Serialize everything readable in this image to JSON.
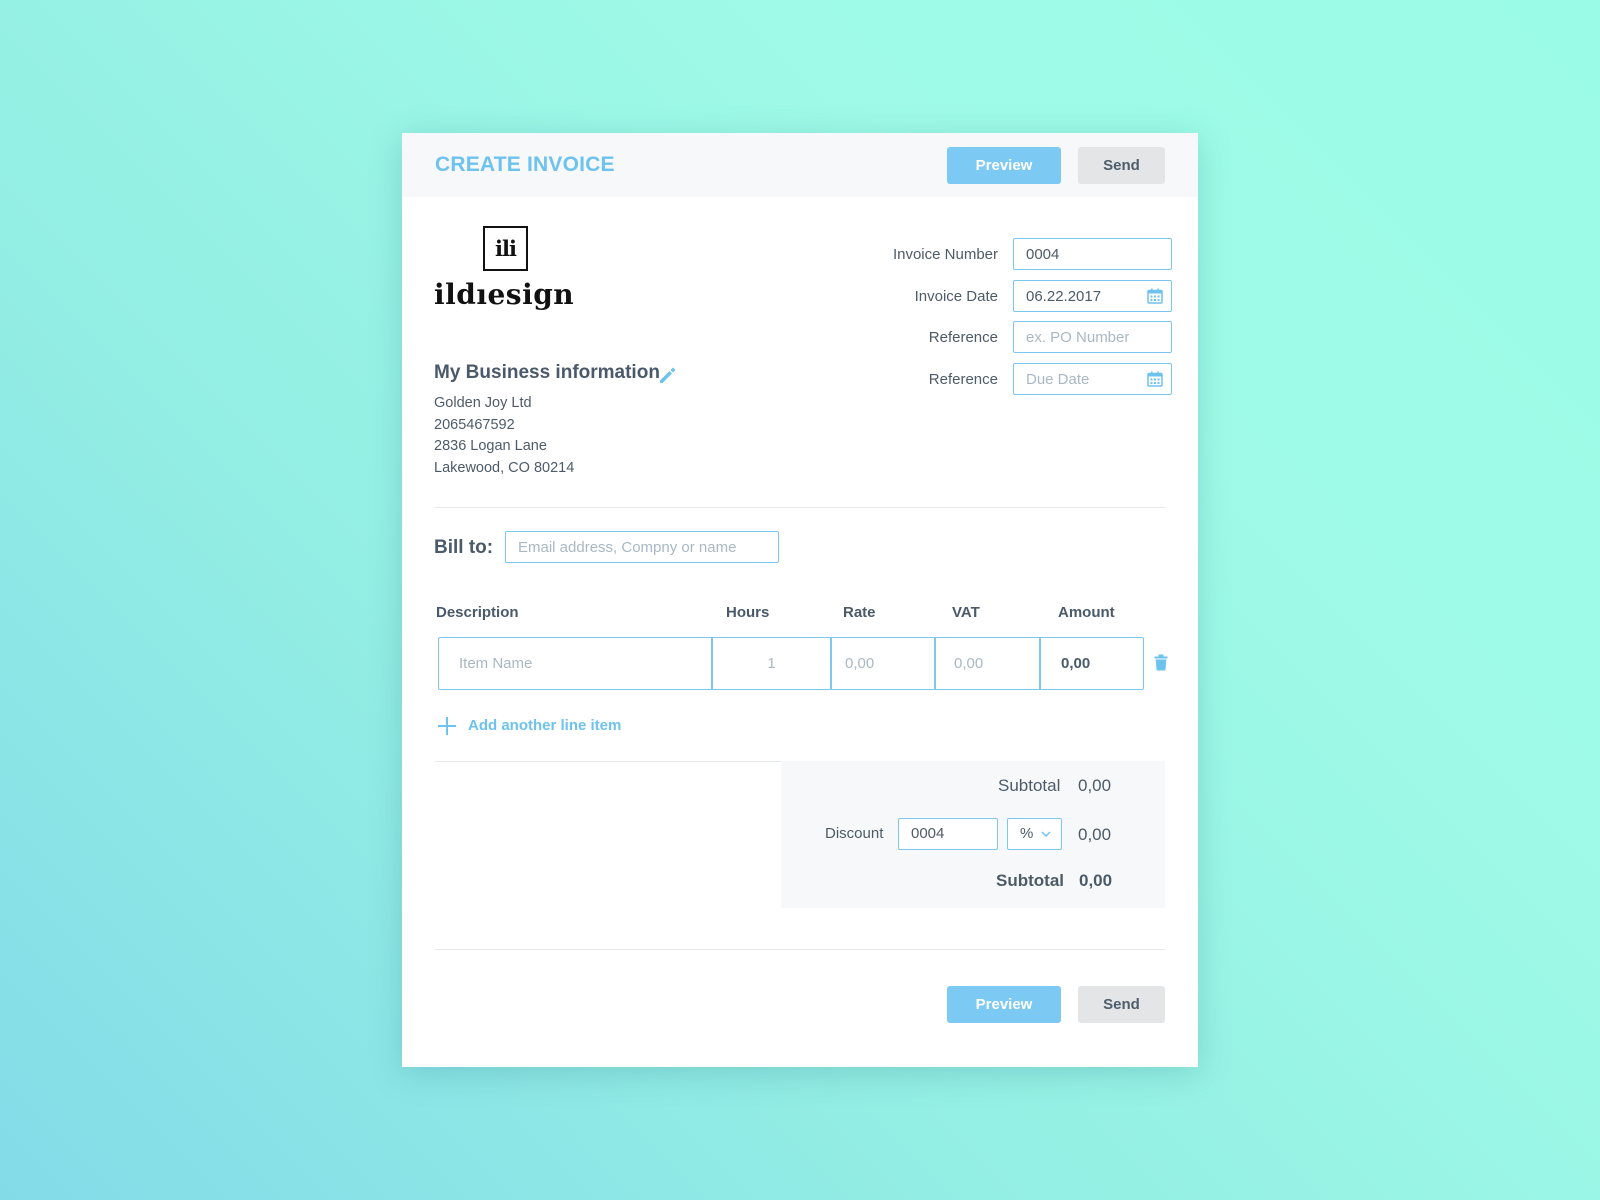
{
  "header": {
    "title": "CREATE INVOICE",
    "preview_label": "Preview",
    "send_label": "Send"
  },
  "logo": {
    "box_text": "ili",
    "word_text": "ildıesign"
  },
  "business": {
    "title": "My Business information",
    "lines": [
      "Golden Joy Ltd",
      "2065467592",
      "2836 Logan Lane",
      "Lakewood, CO 80214"
    ]
  },
  "fields": {
    "invoice_number": {
      "label": "Invoice Number",
      "value": "0004"
    },
    "invoice_date": {
      "label": "Invoice Date",
      "value": "06.22.2017"
    },
    "reference": {
      "label": "Reference",
      "placeholder": "ex. PO Number"
    },
    "due_date": {
      "label": "Reference",
      "placeholder": "Due Date"
    }
  },
  "bill_to": {
    "label": "Bill to:",
    "placeholder": "Email address, Compny or name"
  },
  "table": {
    "headers": [
      "Description",
      "Hours",
      "Rate",
      "VAT",
      "Amount"
    ],
    "row": {
      "item_placeholder": "Item Name",
      "hours": "1",
      "rate": "0,00",
      "vat": "0,00",
      "amount": "0,00"
    }
  },
  "add_line_label": "Add another line item",
  "totals": {
    "subtotal_label": "Subtotal",
    "subtotal_value": "0,00",
    "discount_label": "Discount",
    "discount_input": "0004",
    "discount_unit": "%",
    "discount_value": "0,00",
    "total_label": "Subtotal",
    "total_value": "0,00"
  },
  "footer": {
    "preview_label": "Preview",
    "send_label": "Send"
  },
  "colors": {
    "accent": "#7ccaf4",
    "title": "#6ec2ee",
    "text": "#4a5a6a",
    "border": "#7cc6ef"
  }
}
